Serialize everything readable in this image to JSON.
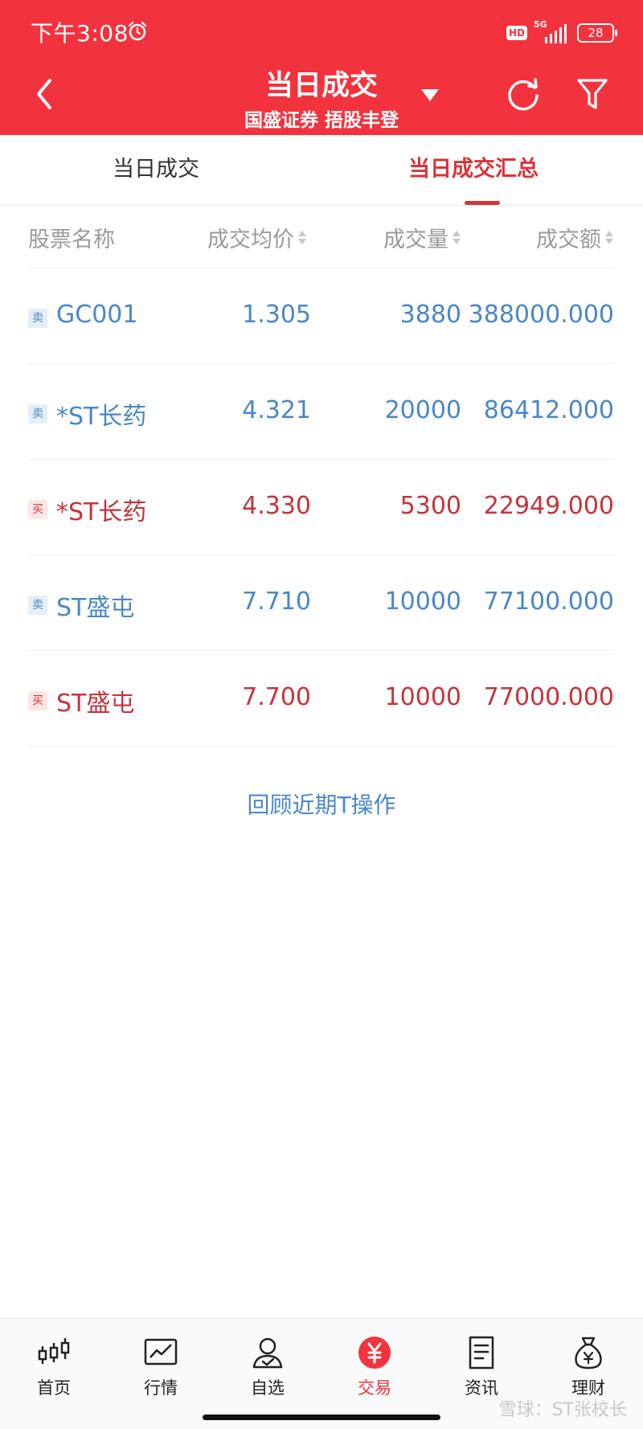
{
  "status_bar": {
    "time": "下午3:08",
    "hd": "HD",
    "network": "5G",
    "battery": "28"
  },
  "header": {
    "title": "当日成交",
    "subtitle": "国盛证券 捂股丰登",
    "dropdown_icon": "triangle-down-icon",
    "back_icon": "chevron-left-icon",
    "refresh_icon": "refresh-icon",
    "filter_icon": "filter-icon",
    "background_color": "#f2333e"
  },
  "tabs": [
    {
      "label": "当日成交",
      "active": false
    },
    {
      "label": "当日成交汇总",
      "active": true
    }
  ],
  "columns": [
    "股票名称",
    "成交均价",
    "成交量",
    "成交额"
  ],
  "rows": [
    {
      "side": "卖",
      "name": "GC001",
      "price": "1.305",
      "volume": "3880",
      "amount": "388000.000"
    },
    {
      "side": "卖",
      "name": "*ST长药",
      "price": "4.321",
      "volume": "20000",
      "amount": "86412.000"
    },
    {
      "side": "买",
      "name": "*ST长药",
      "price": "4.330",
      "volume": "5300",
      "amount": "22949.000"
    },
    {
      "side": "卖",
      "name": "ST盛屯",
      "price": "7.710",
      "volume": "10000",
      "amount": "77100.000"
    },
    {
      "side": "买",
      "name": "ST盛屯",
      "price": "7.700",
      "volume": "10000",
      "amount": "77000.000"
    }
  ],
  "review_link": "回顾近期T操作",
  "bottom_nav": [
    {
      "label": "首页",
      "icon": "candlestick-icon"
    },
    {
      "label": "行情",
      "icon": "market-chart-icon"
    },
    {
      "label": "自选",
      "icon": "person-check-icon"
    },
    {
      "label": "交易",
      "icon": "yuan-icon",
      "active": true
    },
    {
      "label": "资讯",
      "icon": "document-icon"
    },
    {
      "label": "理财",
      "icon": "money-bag-icon"
    }
  ],
  "watermark": "雪球：ST张校长",
  "colors": {
    "sell": "#4a86c8",
    "buy": "#c8323a",
    "accent": "#f2333e"
  }
}
